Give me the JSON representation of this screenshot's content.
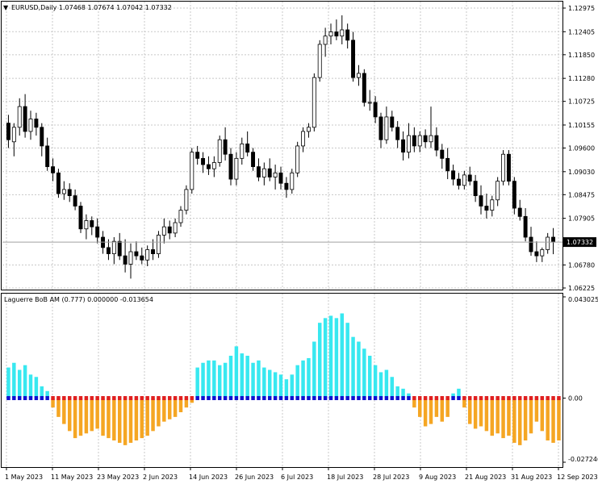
{
  "main_chart": {
    "title": "EURUSD,Daily  1.07468 1.07674 1.07042 1.07332",
    "current_price_label": "1.07332",
    "current_price": 1.07332,
    "y_ticks": [
      "1.12975",
      "1.12405",
      "1.11850",
      "1.11280",
      "1.10725",
      "1.10155",
      "1.09600",
      "1.09030",
      "1.08475",
      "1.07905",
      "1.07332",
      "1.06780",
      "1.06225"
    ],
    "y_tick_values": [
      1.12975,
      1.12405,
      1.1185,
      1.1128,
      1.10725,
      1.10155,
      1.096,
      1.0903,
      1.08475,
      1.07905,
      1.0678,
      1.06225
    ],
    "ylim": [
      1.06225,
      1.12975
    ],
    "grid": true
  },
  "indicator": {
    "title": "Laguerre BoB AM (0.777) 0.000000 -0.013654",
    "y_ticks": [
      "0.043025",
      "0.00",
      "-0.027246"
    ],
    "ylim": [
      -0.027246,
      0.043025
    ]
  },
  "x_ticks": [
    "1 May 2023",
    "11 May 2023",
    "23 May 2023",
    "2 Jun 2023",
    "14 Jun 2023",
    "26 Jun 2023",
    "6 Jul 2023",
    "18 Jul 2023",
    "28 Jul 2023",
    "9 Aug 2023",
    "21 Aug 2023",
    "31 Aug 2023",
    "12 Sep 2023"
  ],
  "colors": {
    "bull_body": "#ffffff",
    "bear_body": "#000000",
    "grid": "#c8c8c8",
    "pos_hist": "#38e8f0",
    "neg_hist": "#f5a623",
    "dot_blue": "#1010d0",
    "dot_red": "#e02020"
  },
  "chart_data": [
    {
      "type": "candlestick",
      "name": "EURUSD,Daily",
      "candles": [
        [
          1.102,
          1.104,
          1.096,
          1.098
        ],
        [
          1.0975,
          1.102,
          1.094,
          1.101
        ],
        [
          1.101,
          1.108,
          1.099,
          1.106
        ],
        [
          1.106,
          1.109,
          1.0985,
          1.1
        ],
        [
          1.1,
          1.105,
          1.098,
          1.103
        ],
        [
          1.103,
          1.1045,
          1.099,
          1.101
        ],
        [
          1.101,
          1.102,
          1.094,
          1.0965
        ],
        [
          1.0965,
          1.0985,
          1.0905,
          1.0915
        ],
        [
          1.0915,
          1.0935,
          1.088,
          1.09
        ],
        [
          1.09,
          1.091,
          1.084,
          1.085
        ],
        [
          1.085,
          1.088,
          1.0835,
          1.086
        ],
        [
          1.086,
          1.0875,
          1.083,
          1.0845
        ],
        [
          1.0845,
          1.086,
          1.081,
          1.082
        ],
        [
          1.082,
          1.083,
          1.0755,
          1.0765
        ],
        [
          1.0765,
          1.08,
          1.074,
          1.0785
        ],
        [
          1.0785,
          1.0795,
          1.075,
          1.077
        ],
        [
          1.077,
          1.079,
          1.073,
          1.0745
        ],
        [
          1.0745,
          1.076,
          1.0705,
          1.072
        ],
        [
          1.072,
          1.074,
          1.069,
          1.0705
        ],
        [
          1.0705,
          1.0745,
          1.068,
          1.0735
        ],
        [
          1.0735,
          1.0755,
          1.069,
          1.07
        ],
        [
          1.07,
          1.074,
          1.066,
          1.068
        ],
        [
          1.068,
          1.073,
          1.0645,
          1.071
        ],
        [
          1.071,
          1.0735,
          1.069,
          1.07
        ],
        [
          1.07,
          1.072,
          1.068,
          1.069
        ],
        [
          1.069,
          1.0725,
          1.0675,
          1.0715
        ],
        [
          1.0715,
          1.074,
          1.069,
          1.0705
        ],
        [
          1.0705,
          1.076,
          1.0695,
          1.075
        ],
        [
          1.075,
          1.079,
          1.073,
          1.077
        ],
        [
          1.077,
          1.0785,
          1.074,
          1.0755
        ],
        [
          1.0755,
          1.079,
          1.0745,
          1.078
        ],
        [
          1.078,
          1.082,
          1.077,
          1.081
        ],
        [
          1.081,
          1.087,
          1.08,
          1.086
        ],
        [
          1.086,
          1.096,
          1.085,
          1.095
        ],
        [
          1.095,
          1.0965,
          1.092,
          1.0935
        ],
        [
          1.0935,
          1.095,
          1.09,
          1.092
        ],
        [
          1.092,
          1.094,
          1.0895,
          1.091
        ],
        [
          1.091,
          1.094,
          1.089,
          1.0925
        ],
        [
          1.0925,
          1.099,
          1.0915,
          1.098
        ],
        [
          1.098,
          1.101,
          1.093,
          1.0945
        ],
        [
          1.0945,
          1.096,
          1.087,
          1.0885
        ],
        [
          1.0885,
          1.095,
          1.087,
          1.0935
        ],
        [
          1.0935,
          1.0985,
          1.092,
          1.097
        ],
        [
          1.097,
          1.1,
          1.094,
          1.095
        ],
        [
          1.095,
          1.096,
          1.0905,
          1.0915
        ],
        [
          1.0915,
          1.0935,
          1.088,
          1.089
        ],
        [
          1.089,
          1.0925,
          1.087,
          1.091
        ],
        [
          1.091,
          1.0935,
          1.088,
          1.089
        ],
        [
          1.089,
          1.092,
          1.086,
          1.09
        ],
        [
          1.09,
          1.0915,
          1.086,
          1.0875
        ],
        [
          1.0875,
          1.089,
          1.084,
          1.086
        ],
        [
          1.086,
          1.091,
          1.085,
          1.09
        ],
        [
          1.09,
          1.0975,
          1.089,
          1.0965
        ],
        [
          1.0965,
          1.101,
          1.095,
          1.1
        ],
        [
          1.1,
          1.102,
          1.0985,
          1.101
        ],
        [
          1.101,
          1.114,
          1.1,
          1.113
        ],
        [
          1.113,
          1.122,
          1.112,
          1.121
        ],
        [
          1.121,
          1.125,
          1.118,
          1.123
        ],
        [
          1.123,
          1.126,
          1.121,
          1.124
        ],
        [
          1.124,
          1.127,
          1.122,
          1.123
        ],
        [
          1.123,
          1.128,
          1.121,
          1.1245
        ],
        [
          1.1245,
          1.126,
          1.12,
          1.122
        ],
        [
          1.122,
          1.124,
          1.112,
          1.113
        ],
        [
          1.113,
          1.116,
          1.111,
          1.114
        ],
        [
          1.114,
          1.115,
          1.106,
          1.107
        ],
        [
          1.107,
          1.11,
          1.105,
          1.107
        ],
        [
          1.107,
          1.1085,
          1.102,
          1.1035
        ],
        [
          1.1035,
          1.1045,
          1.096,
          1.098
        ],
        [
          1.098,
          1.106,
          1.097,
          1.1035
        ],
        [
          1.1035,
          1.105,
          1.1,
          1.101
        ],
        [
          1.101,
          1.1025,
          1.096,
          1.098
        ],
        [
          1.098,
          1.1,
          1.093,
          1.095
        ],
        [
          1.095,
          1.102,
          1.0935,
          1.099
        ],
        [
          1.099,
          1.101,
          1.095,
          1.0965
        ],
        [
          1.0965,
          1.1,
          1.095,
          1.099
        ],
        [
          1.099,
          1.1005,
          1.096,
          1.0975
        ],
        [
          1.0975,
          1.106,
          1.096,
          1.099
        ],
        [
          1.099,
          1.101,
          1.094,
          1.0955
        ],
        [
          1.0955,
          1.097,
          1.091,
          1.0935
        ],
        [
          1.0935,
          1.096,
          1.0885,
          1.0905
        ],
        [
          1.0905,
          1.092,
          1.087,
          1.0885
        ],
        [
          1.0885,
          1.09,
          1.086,
          1.087
        ],
        [
          1.087,
          1.0905,
          1.086,
          1.0895
        ],
        [
          1.0895,
          1.0915,
          1.087,
          1.088
        ],
        [
          1.088,
          1.0895,
          1.083,
          1.0845
        ],
        [
          1.0845,
          1.087,
          1.08,
          1.082
        ],
        [
          1.082,
          1.085,
          1.079,
          1.081
        ],
        [
          1.081,
          1.0845,
          1.0795,
          1.0835
        ],
        [
          1.0835,
          1.089,
          1.082,
          1.088
        ],
        [
          1.088,
          1.0955,
          1.087,
          1.0945
        ],
        [
          1.0945,
          1.0955,
          1.087,
          1.088
        ],
        [
          1.088,
          1.089,
          1.08,
          1.0815
        ],
        [
          1.0815,
          1.0835,
          1.0785,
          1.0795
        ],
        [
          1.0795,
          1.0815,
          1.0735,
          1.0745
        ],
        [
          1.0745,
          1.077,
          1.07,
          1.071
        ],
        [
          1.071,
          1.0735,
          1.0685,
          1.07
        ],
        [
          1.07,
          1.072,
          1.0685,
          1.0715
        ],
        [
          1.0715,
          1.0755,
          1.0705,
          1.0745
        ],
        [
          1.0745,
          1.0767,
          1.0704,
          1.0733
        ]
      ]
    },
    {
      "type": "bar",
      "name": "Laguerre BoB AM (0.777)",
      "values": [
        0.013,
        0.015,
        0.012,
        0.014,
        0.01,
        0.009,
        0.005,
        0.003,
        -0.004,
        -0.008,
        -0.011,
        -0.014,
        -0.017,
        -0.016,
        -0.015,
        -0.014,
        -0.013,
        -0.016,
        -0.017,
        -0.018,
        -0.019,
        -0.02,
        -0.019,
        -0.018,
        -0.017,
        -0.016,
        -0.014,
        -0.012,
        -0.01,
        -0.009,
        -0.008,
        -0.006,
        -0.004,
        -0.002,
        0.013,
        0.015,
        0.016,
        0.016,
        0.014,
        0.015,
        0.018,
        0.022,
        0.019,
        0.018,
        0.015,
        0.016,
        0.013,
        0.012,
        0.011,
        0.01,
        0.008,
        0.01,
        0.014,
        0.016,
        0.017,
        0.024,
        0.032,
        0.034,
        0.035,
        0.034,
        0.036,
        0.032,
        0.026,
        0.024,
        0.021,
        0.018,
        0.014,
        0.011,
        0.012,
        0.009,
        0.005,
        0.004,
        0.002,
        -0.004,
        -0.008,
        -0.012,
        -0.011,
        -0.008,
        -0.01,
        -0.008,
        0.002,
        0.004,
        -0.004,
        -0.011,
        -0.013,
        -0.012,
        -0.014,
        -0.016,
        -0.015,
        -0.017,
        -0.016,
        -0.019,
        -0.02,
        -0.018,
        -0.015,
        -0.01,
        -0.014,
        -0.018,
        -0.019,
        -0.018
      ],
      "dots": [
        "b",
        "b",
        "b",
        "b",
        "b",
        "b",
        "b",
        "b",
        "r",
        "r",
        "r",
        "r",
        "r",
        "r",
        "r",
        "r",
        "r",
        "r",
        "r",
        "r",
        "r",
        "r",
        "r",
        "r",
        "r",
        "r",
        "r",
        "r",
        "r",
        "r",
        "r",
        "r",
        "r",
        "r",
        "b",
        "b",
        "b",
        "b",
        "b",
        "b",
        "b",
        "b",
        "b",
        "b",
        "b",
        "b",
        "b",
        "b",
        "b",
        "b",
        "b",
        "b",
        "b",
        "b",
        "b",
        "b",
        "b",
        "b",
        "b",
        "b",
        "b",
        "b",
        "b",
        "b",
        "b",
        "b",
        "b",
        "b",
        "b",
        "b",
        "b",
        "b",
        "b",
        "r",
        "r",
        "r",
        "r",
        "r",
        "r",
        "r",
        "b",
        "b",
        "r",
        "r",
        "r",
        "r",
        "r",
        "r",
        "r",
        "r",
        "r",
        "r",
        "r",
        "r",
        "r",
        "r",
        "r",
        "r",
        "r",
        "r"
      ]
    }
  ]
}
